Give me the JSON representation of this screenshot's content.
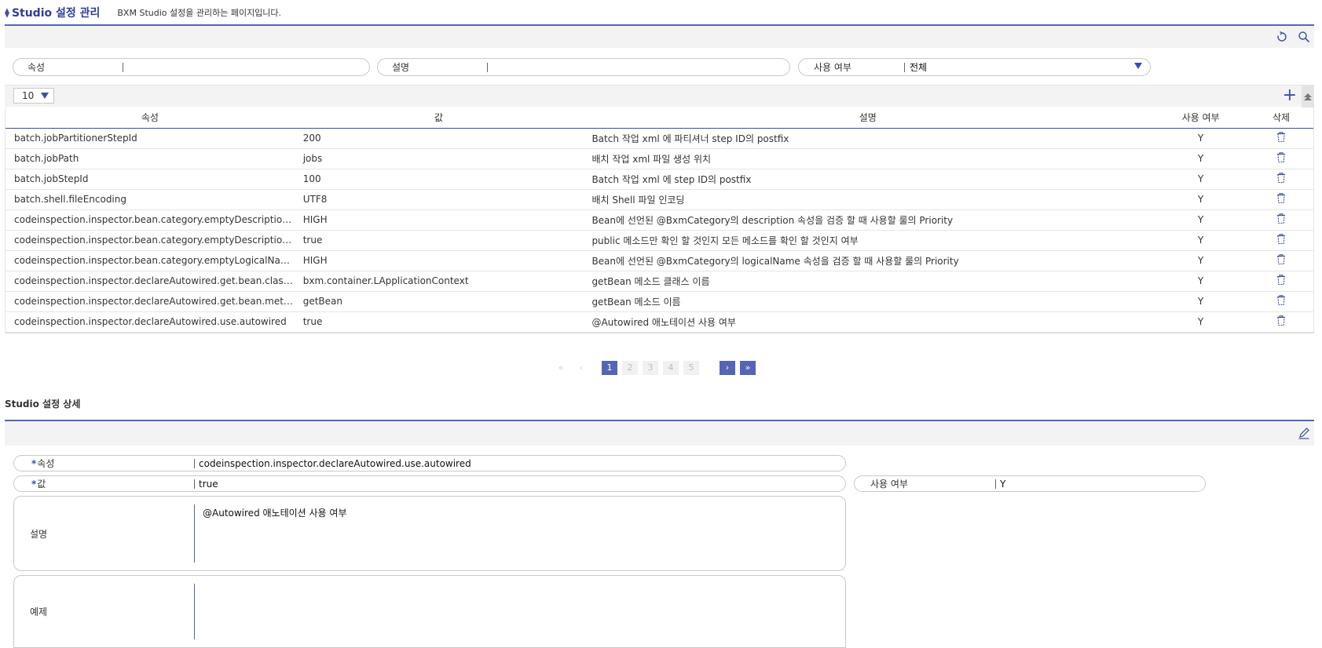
{
  "header": {
    "title": "Studio 설정 관리",
    "description": "BXM Studio 설정을 관리하는 페이지입니다."
  },
  "search": {
    "attribute_label": "속성",
    "attribute_value": "",
    "description_label": "설명",
    "description_value": "",
    "use_label": "사용 여부",
    "use_value": "전체"
  },
  "grid": {
    "page_size": "10",
    "columns": [
      "속성",
      "값",
      "설명",
      "사용 여부",
      "삭제"
    ],
    "rows": [
      {
        "attr": "batch.jobPartitionerStepId",
        "value": "200",
        "desc": "Batch 작업 xml 에 파티셔너 step ID의 postfix",
        "use": "Y"
      },
      {
        "attr": "batch.jobPath",
        "value": "jobs",
        "desc": "배치 작업 xml 파일 생성 위치",
        "use": "Y"
      },
      {
        "attr": "batch.jobStepId",
        "value": "100",
        "desc": "Batch 작업 xml 에 step ID의 postfix",
        "use": "Y"
      },
      {
        "attr": "batch.shell.fileEncoding",
        "value": "UTF8",
        "desc": "배치 Shell 파일 인코딩",
        "use": "Y"
      },
      {
        "attr": "codeinspection.inspector.bean.category.emptyDescription.prior…",
        "value": "HIGH",
        "desc": "Bean에 선언된 @BxmCategory의 description 속성을 검증 할 때 사용할 룰의 Priority",
        "use": "Y"
      },
      {
        "attr": "codeinspection.inspector.bean.category.emptyDescription.publ…",
        "value": "true",
        "desc": "public 메소드만 확인 할 것인지 모든 메소드를 확인 할 것인지 여부",
        "use": "Y"
      },
      {
        "attr": "codeinspection.inspector.bean.category.emptyLogicalName.pri…",
        "value": "HIGH",
        "desc": "Bean에 선언된 @BxmCategory의 logicalName 속성을 검증 할 때 사용할 룰의 Priority",
        "use": "Y"
      },
      {
        "attr": "codeinspection.inspector.declareAutowired.get.bean.class.name",
        "value": "bxm.container.LApplicationContext",
        "desc": "getBean 메소드 클래스 이름",
        "use": "Y"
      },
      {
        "attr": "codeinspection.inspector.declareAutowired.get.bean.method.n…",
        "value": "getBean",
        "desc": "getBean 메소드 이름",
        "use": "Y"
      },
      {
        "attr": "codeinspection.inspector.declareAutowired.use.autowired",
        "value": "true",
        "desc": "@Autowired 애노테이션 사용 여부",
        "use": "Y"
      }
    ]
  },
  "pagination": {
    "first": "«",
    "prev": "‹",
    "pages": [
      "1",
      "2",
      "3",
      "4",
      "5"
    ],
    "active": "1",
    "next": "›",
    "last": "»"
  },
  "detail": {
    "title": "Studio 설정 상세",
    "required_mark": "*",
    "attribute_label": "속성",
    "attribute_value": "codeinspection.inspector.declareAutowired.use.autowired",
    "value_label": "값",
    "value_value": "true",
    "use_label": "사용 여부",
    "use_value": "Y",
    "description_label": "설명",
    "description_value": "@Autowired 애노테이션 사용 여부",
    "example_label": "예제",
    "example_value": ""
  },
  "colors": {
    "accent": "#3d4fa3",
    "accent_light": "#5565b3",
    "toolbar_bg": "#f3f3f3"
  },
  "icons": {
    "refresh": "refresh-icon",
    "search": "search-icon",
    "add": "plus-icon",
    "delete": "trash-icon",
    "edit": "pencil-icon"
  }
}
